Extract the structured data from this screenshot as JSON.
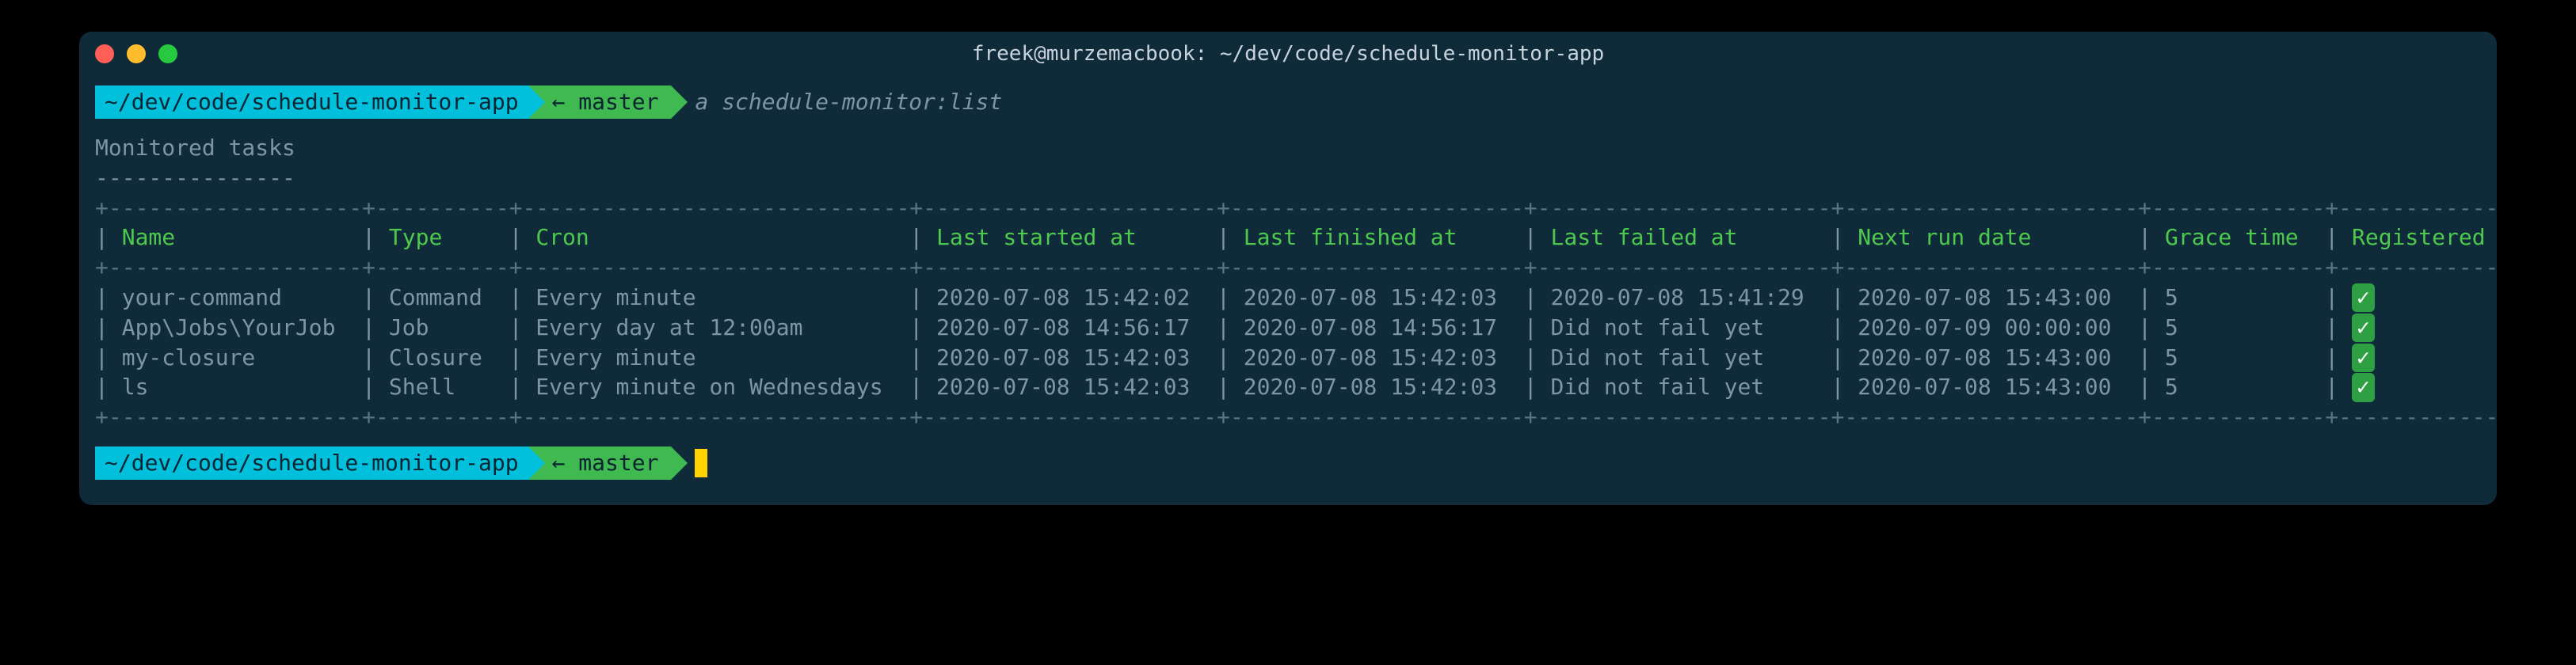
{
  "window": {
    "title": "freek@murzemacbook: ~/dev/code/schedule-monitor-app"
  },
  "prompt1": {
    "path": "~/dev/code/schedule-monitor-app",
    "branch": "← master",
    "command": "a schedule-monitor:list"
  },
  "heading": "Monitored tasks",
  "heading_underline": "---------------",
  "table": {
    "headers": {
      "name": "Name",
      "type": "Type",
      "cron": "Cron",
      "last_started": "Last started at",
      "last_finished": "Last finished at",
      "last_failed": "Last failed at",
      "next_run": "Next run date",
      "grace": "Grace time",
      "registered": "Registered at Oh Dear"
    },
    "rows": [
      {
        "name": "your-command",
        "type": "Command",
        "cron": "Every minute",
        "last_started": "2020-07-08 15:42:02",
        "last_finished": "2020-07-08 15:42:03",
        "last_failed": "2020-07-08 15:41:29",
        "next_run": "2020-07-08 15:43:00",
        "grace": "5",
        "registered": "✓"
      },
      {
        "name": "App\\Jobs\\YourJob",
        "type": "Job",
        "cron": "Every day at 12:00am",
        "last_started": "2020-07-08 14:56:17",
        "last_finished": "2020-07-08 14:56:17",
        "last_failed": "Did not fail yet",
        "next_run": "2020-07-09 00:00:00",
        "grace": "5",
        "registered": "✓"
      },
      {
        "name": "my-closure",
        "type": "Closure",
        "cron": "Every minute",
        "last_started": "2020-07-08 15:42:03",
        "last_finished": "2020-07-08 15:42:03",
        "last_failed": "Did not fail yet",
        "next_run": "2020-07-08 15:43:00",
        "grace": "5",
        "registered": "✓"
      },
      {
        "name": "ls",
        "type": "Shell",
        "cron": "Every minute on Wednesdays",
        "last_started": "2020-07-08 15:42:03",
        "last_finished": "2020-07-08 15:42:03",
        "last_failed": "Did not fail yet",
        "next_run": "2020-07-08 15:43:00",
        "grace": "5",
        "registered": "✓"
      }
    ]
  },
  "prompt2": {
    "path": "~/dev/code/schedule-monitor-app",
    "branch": "← master"
  },
  "widths": {
    "name": 17,
    "type": 8,
    "cron": 27,
    "last_started": 20,
    "last_finished": 20,
    "last_failed": 20,
    "next_run": 20,
    "grace": 11,
    "registered": 22
  }
}
